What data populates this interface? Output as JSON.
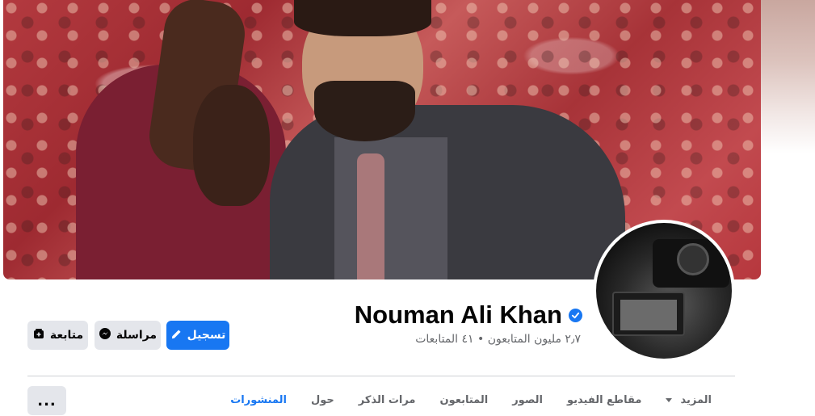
{
  "profile": {
    "name": "Nouman Ali Khan",
    "verified": true,
    "followers_line": "٢٫٧ مليون المتابعون • ٤١ المتابعات"
  },
  "actions": {
    "primary_label": "تسجيل",
    "message_label": "مراسلة",
    "follow_label": "متابعة",
    "more_label": "..."
  },
  "tabs": [
    {
      "label": "المنشورات",
      "active": true
    },
    {
      "label": "حول"
    },
    {
      "label": "مرات الذكر"
    },
    {
      "label": "المتابعون"
    },
    {
      "label": "الصور"
    },
    {
      "label": "مقاطع الفيديو"
    },
    {
      "label": "المزيد"
    }
  ],
  "colors": {
    "accent": "#1877f2",
    "secondary_button": "#e4e6eb",
    "text_primary": "#050505",
    "text_secondary": "#65676b"
  },
  "icons": {
    "verified": "verified-badge-icon",
    "primary": "pencil-icon",
    "message": "messenger-icon",
    "follow": "follow-icon",
    "more_tab": "caret-down-icon"
  }
}
